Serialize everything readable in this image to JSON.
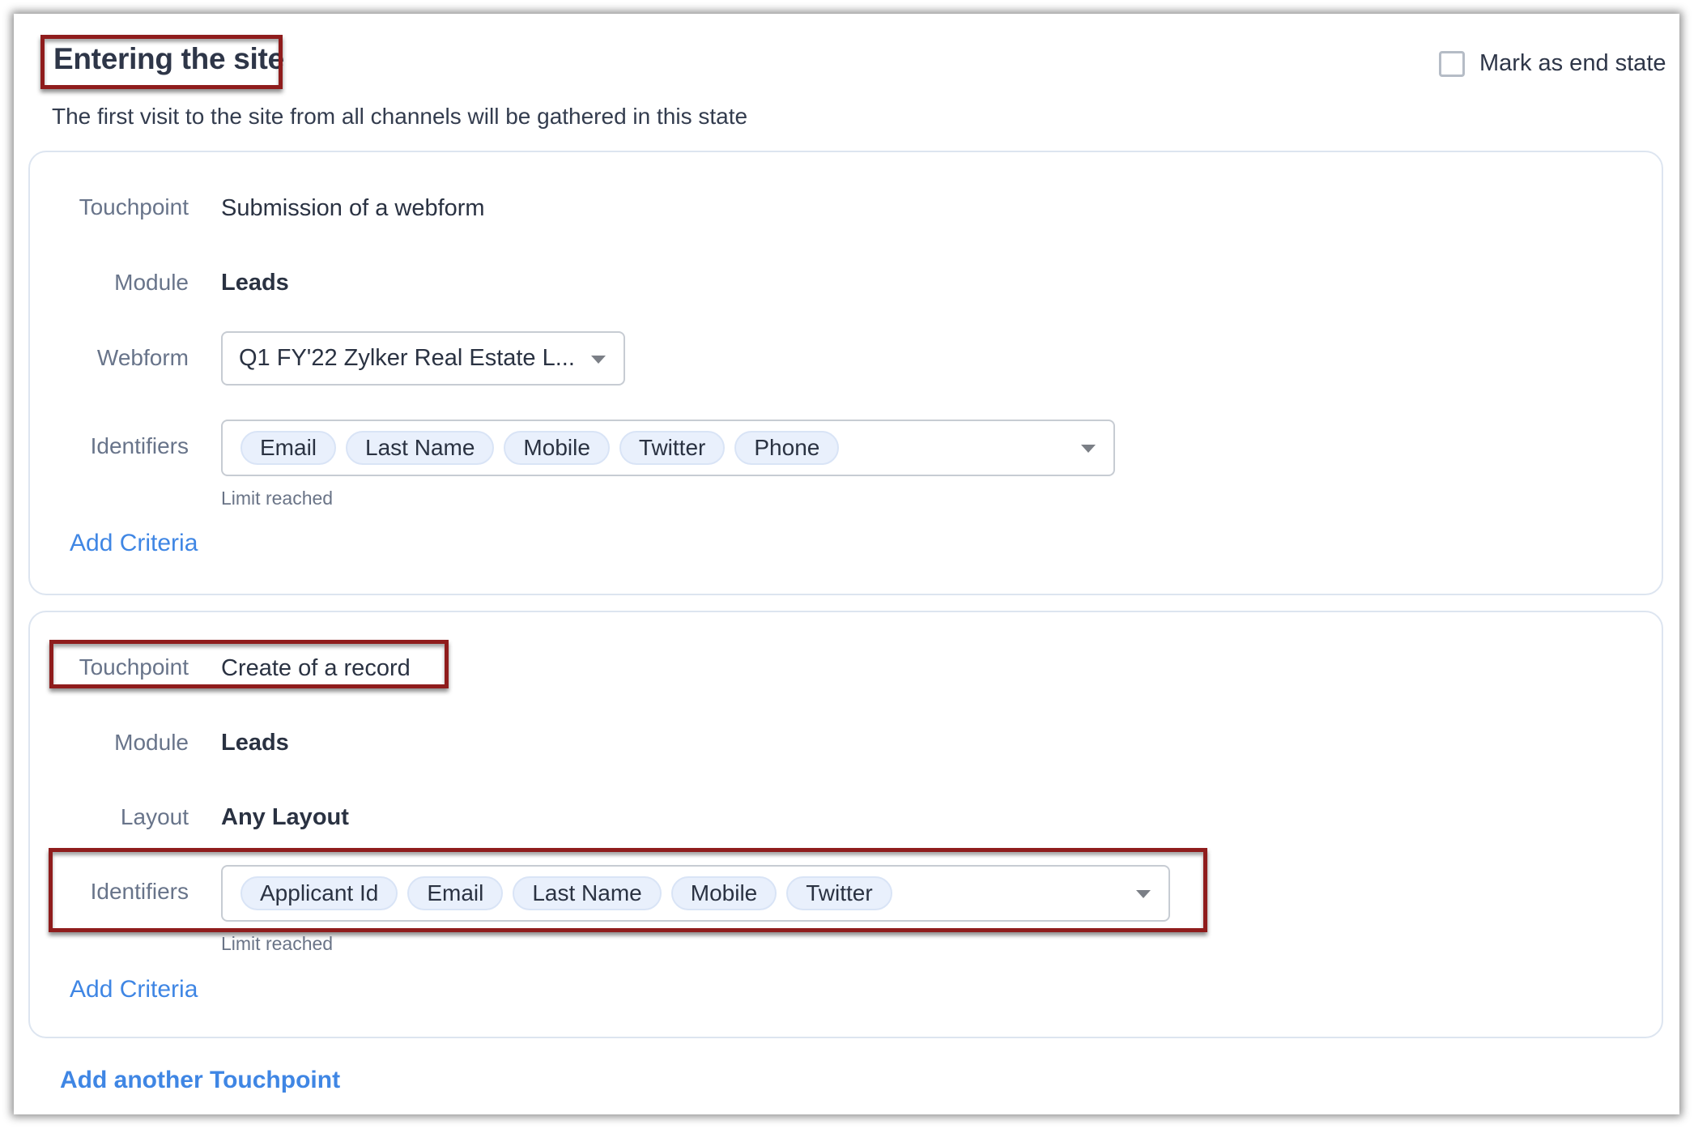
{
  "state": {
    "title": "Entering the site",
    "description": "The first visit to the site from all channels will be gathered in this state",
    "mark_end_state": {
      "label": "Mark as end state",
      "checked": false
    }
  },
  "touchpoints": [
    {
      "touchpoint_label": "Touchpoint",
      "touchpoint_value": "Submission of a webform",
      "module_label": "Module",
      "module_value": "Leads",
      "webform_label": "Webform",
      "webform_value": "Q1 FY'22 Zylker Real Estate L...",
      "identifiers_label": "Identifiers",
      "identifiers": [
        "Email",
        "Last Name",
        "Mobile",
        "Twitter",
        "Phone"
      ],
      "identifiers_hint": "Limit reached",
      "add_criteria": "Add Criteria"
    },
    {
      "touchpoint_label": "Touchpoint",
      "touchpoint_value": "Create of a record",
      "module_label": "Module",
      "module_value": "Leads",
      "layout_label": "Layout",
      "layout_value": "Any Layout",
      "identifiers_label": "Identifiers",
      "identifiers": [
        "Applicant Id",
        "Email",
        "Last Name",
        "Mobile",
        "Twitter"
      ],
      "identifiers_hint": "Limit reached",
      "add_criteria": "Add Criteria"
    }
  ],
  "add_touchpoint": "Add another Touchpoint",
  "colors": {
    "link": "#3f86e4",
    "highlight_box": "#8f1c1c",
    "chip_bg": "#e9f0fc"
  }
}
